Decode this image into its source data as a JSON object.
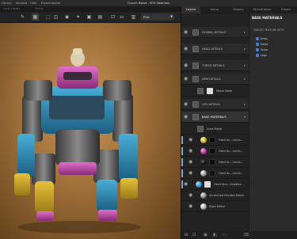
{
  "menubar": {
    "items": [
      "Library",
      "Window",
      "Help",
      "Experimental"
    ],
    "title": "Crunch Robot - MTS Materials"
  },
  "document_tabs": [
    "Local Library",
    "Online"
  ],
  "toolbar": {
    "view_mode": "3D",
    "preset": "Plas"
  },
  "panel_tabs": [
    "Layers",
    "Setup",
    "Display",
    "Performance",
    "Export"
  ],
  "layers": [
    {
      "label": "GLOBAL DETAILS",
      "type": "folder"
    },
    {
      "label": "HEAD DETAILS",
      "type": "folder"
    },
    {
      "label": "TORSO DETAILS",
      "type": "folder"
    },
    {
      "label": "ARM DETAILS",
      "type": "folder"
    },
    {
      "label": "Metal Mask",
      "type": "sub"
    },
    {
      "label": "LEG DETAILS",
      "type": "folder"
    },
    {
      "label": "BASE MATERIALS",
      "type": "folder",
      "selected": true
    },
    {
      "label": "Dust Metal",
      "type": "sub"
    },
    {
      "label": "Hard An...lumin...",
      "type": "material",
      "color": "#d8c030"
    },
    {
      "label": "Hard An...lumin...",
      "type": "material",
      "color": "#c040a8"
    },
    {
      "label": "Hard An...lumin...",
      "type": "material",
      "color": "#1a1a1a"
    },
    {
      "label": "Hard An...lumin...",
      "type": "material",
      "color": "#a0a0a0"
    },
    {
      "label": "Hard Anu...Anodiza...",
      "type": "material",
      "color": "#3aa0d0"
    },
    {
      "label": "Scratched Painted Metal",
      "type": "material",
      "color": "#909090"
    },
    {
      "label": "Base Metal",
      "type": "material",
      "color": "#b8b8b8"
    }
  ],
  "properties": {
    "title": "BASE MATERIALS",
    "subtitle": "TARGET TEXTURE SETS",
    "sets": [
      "Arms",
      "Head",
      "Torso",
      "Legs"
    ]
  },
  "colors": {
    "panel_bg": "#262626",
    "accent": "#3c7dd9",
    "viewport_bg": "#a8773f"
  }
}
